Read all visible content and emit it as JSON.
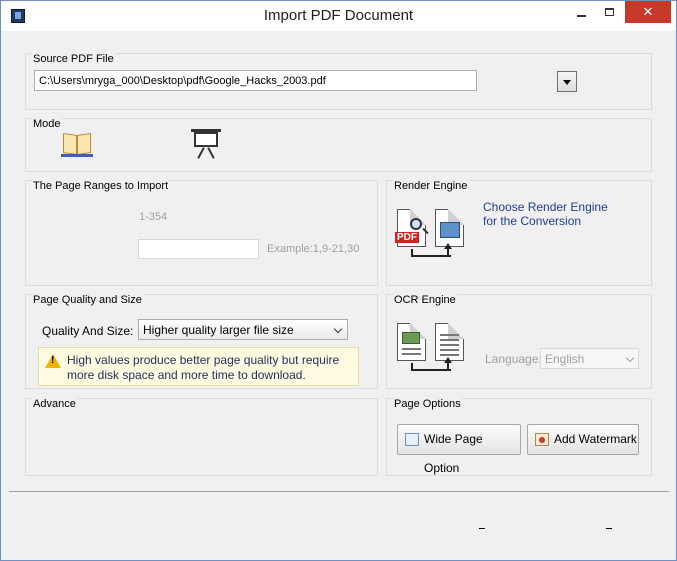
{
  "window": {
    "title": "Import PDF Document"
  },
  "source": {
    "title": "Source PDF File",
    "path": "C:\\Users\\mryga_000\\Desktop\\pdf\\Google_Hacks_2003.pdf"
  },
  "mode": {
    "title": "Mode",
    "options": [
      "book-icon",
      "easel-icon"
    ]
  },
  "ranges": {
    "title": "The Page Ranges to Import",
    "range": "1-354",
    "input_value": "",
    "example": "Example:1,9-21,30"
  },
  "render": {
    "title": "Render Engine",
    "link_line1": "Choose Render Engine",
    "link_line2": "for the Conversion",
    "pdf_tag": "PDF"
  },
  "quality": {
    "title": "Page Quality and Size",
    "label": "Quality And Size:",
    "selected": "Higher quality larger file size",
    "warning": "High values produce better page quality but require more disk space and more time to download."
  },
  "ocr": {
    "title": "OCR Engine",
    "language_label": "Language:",
    "language": "English"
  },
  "advance": {
    "title": "Advance"
  },
  "page_options": {
    "title": "Page Options",
    "wide_page": "Wide Page Option",
    "watermark": "Add Watermark"
  },
  "colors": {
    "close": "#c7392b",
    "link": "#1f3d9e",
    "warning_bg": "#fffbe0"
  }
}
